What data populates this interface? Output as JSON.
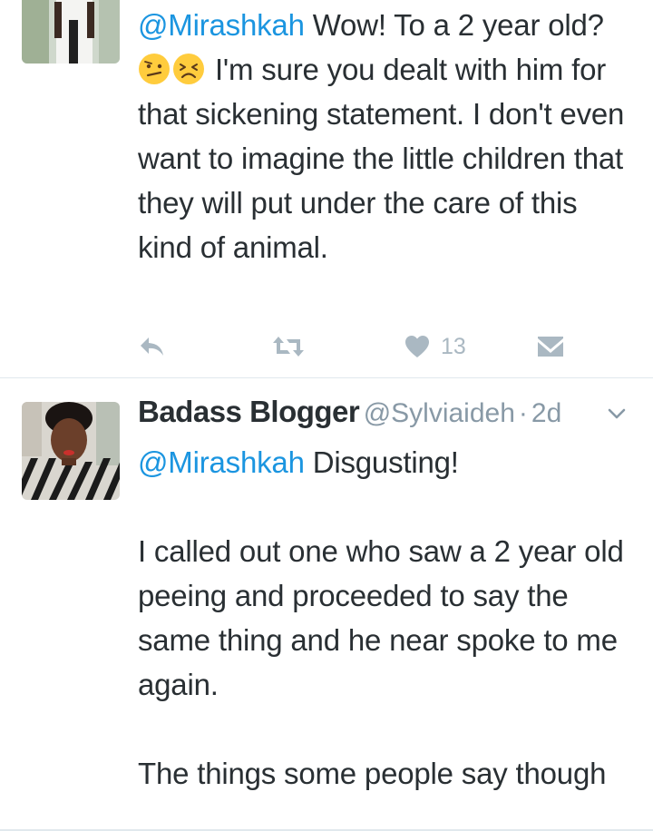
{
  "tweets": [
    {
      "mention": "@Mirashkah",
      "text_1": " Wow! To a 2 year old? ",
      "emojis": [
        "confused-face-icon",
        "persevering-face-icon"
      ],
      "text_2": " I'm sure you dealt with him for that sickening statement. I don't even want to imagine the little children that they will put under the care of this kind of animal.",
      "like_count": "13"
    },
    {
      "author_name": "Badass Blogger",
      "author_handle": "@Sylviaideh",
      "separator": "·",
      "time": "2d",
      "mention": "@Mirashkah",
      "text_1": " Disgusting!",
      "paragraph_2": "I called out one who saw a 2 year old peeing and proceeded to say the same thing and he near spoke to me again.",
      "paragraph_3": "The things some people say though"
    }
  ],
  "colors": {
    "link": "#1b95e0",
    "text": "#292f33",
    "muted": "#8899a6",
    "icon": "#aab8c2",
    "divider": "#e1e8ed"
  },
  "icons": [
    "reply-icon",
    "retweet-icon",
    "heart-icon",
    "message-icon",
    "chevron-down-icon"
  ]
}
